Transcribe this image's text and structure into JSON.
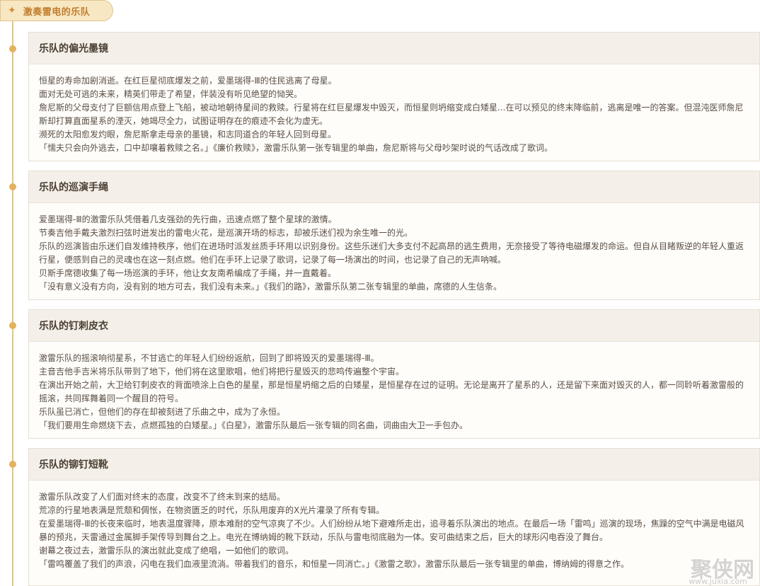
{
  "title": "激奏雷电的乐队",
  "sections": [
    {
      "heading": "乐队的偏光墨镜",
      "lines": [
        "恒星的寿命加剧消逝。在红巨星彻底爆发之前，爱墨瑞得-Ⅲ的住民逃离了母星。",
        "面对无处可逃的未来，精英们带走了希望，伴装没有听见绝望的恸哭。",
        "詹尼斯的父母支付了巨额信用点登上飞船，被动地朝待星间的救赎。行星将在红巨星爆发中毁灭，而恒星则坍缩变成白矮星...在可以预见的终末降临前，逃离是唯一的答案。但混沌医师詹尼斯却打算直面星系的湮灭，她竭尽全力，试图证明存在的痕迹不会化为虚无。",
        "濒死的太阳愈发灼眼，詹尼斯拿走母亲的墨镜，和志同道合的年轻人回到母星。",
        "「懦夫只会向外逃去，口中却嚷着救赎之名。」《廉价救赎》，激雷乐队第一张专辑里的单曲，詹尼斯将与父母吵架时说的气话改成了歌词。"
      ]
    },
    {
      "heading": "乐队的巡演手绳",
      "lines": [
        "爱墨瑞得-Ⅲ的激雷乐队凭借着几支强劲的先行曲，迅速点燃了整个星球的激情。",
        "节奏吉他手戴夫激烈扫弦时迸发出的雷电火花，是巡演开场的标志，却被乐迷们视为余生唯一的光。",
        "乐队的巡演皆由乐迷们自发维持秩序，他们在进场时派发丝质手环用以识别身份。这些乐迷们大多支付不起高昂的逃生费用，无奈接受了等待电磁爆发的命运。但自从目睹叛逆的年轻人重返行星，便感到自己的灵魂也在这一刻点燃。他们在手环上记录了歌词，记录了每一场演出的时间，也记录了自己的无声呐喊。",
        "贝斯手席德收集了每一场巡演的手环，他让女友南希编成了手绳，并一直戴着。",
        "「没有意义没有方向，没有别的地方可去，我们没有未来。」《我们的路》，激雷乐队第二张专辑里的单曲，席德的人生信条。"
      ]
    },
    {
      "heading": "乐队的钉刺皮衣",
      "lines": [
        "激雷乐队的摇滚响彻星系，不甘逃亡的年轻人们纷纷返航，回到了即将毁灭的爱墨瑞得-Ⅲ。",
        "主音吉他手吉米将乐队带到了地下，他们将在这里歌唱，他们将把行星毁灭的悲鸣传遍整个宇宙。",
        "在演出开始之前，大卫给钉刺皮衣的背面喷涂上白色的星星，那是恒星坍缩之后的白矮星，是恒星存在过的证明。无论是离开了星系的人，还是留下来面对毁灭的人，都一同聆听着激雷般的摇滚，共同挥舞着同一个醒目的符号。",
        "乐队虽已消亡，但他们的存在却被刻进了乐曲之中，成为了永恒。",
        "「我们要用生命燃烧下去，点燃孤独的白矮星。」《白星》，激雷乐队最后一张专辑的同名曲，词曲由大卫一手包办。"
      ]
    },
    {
      "heading": "乐队的铆钉短靴",
      "lines": [
        "激雷乐队改变了人们面对终末的态度，改变不了终末到来的结局。",
        "荒凉的行星地表满是荒颓和倜怅，在物资匮乏的时代，乐队用废弃的X光片灌录了所有专辑。",
        "在爱墨瑞得-Ⅲ的长夜来临时，地表温度骤降，原本难耐的空气凉爽了不少。人们纷纷从地下避难所走出，追寻着乐队演出的地点。在最后一场「雷鸣」巡演的现场，焦躁的空气中满是电磁风暴的预兆，天雷通过金属脚手架传导到舞台之上。电光在博纳姆的靴下跃动，乐队与雷电彻底融为一体。安可曲结束之后，巨大的球形闪电吞没了舞台。",
        "谢幕之夜过去，激雷乐队的演出就此变成了绝唱，一如他们的歌词。",
        "「雷鸣覆盖了我们的声浪，闪电在我们血液里流淌。带着我们的音乐，和恒星一同消亡。」《激雷之歌》，激雷乐队最后一张专辑里的单曲，博纳姆的得意之作。"
      ]
    }
  ],
  "watermark": {
    "brand": "聚侠网",
    "url": "www.juxia.com"
  }
}
